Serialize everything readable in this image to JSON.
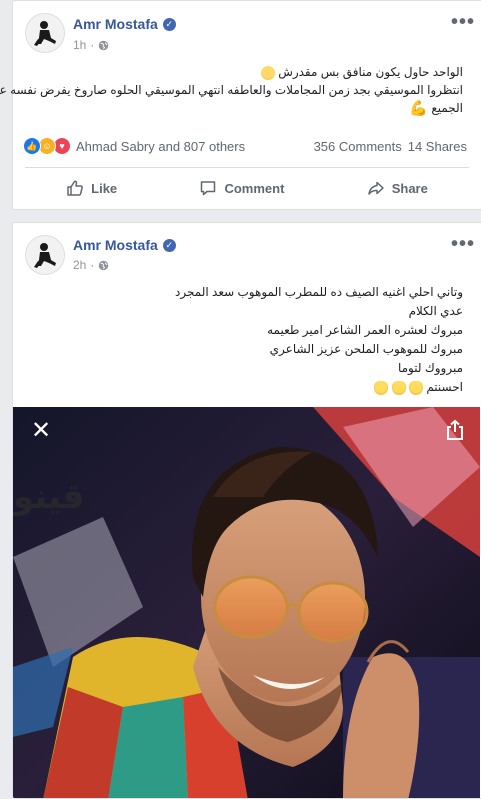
{
  "posts": [
    {
      "author": "Amr Mostafa",
      "time": "1h",
      "text_lines": [
        "الواحد حاول يكون منافق بس مقدرش",
        "انتظروا الموسيقي بجد زمن المجاملات والعاطفه انتهي الموسيقي الحلوه صاروخ يفرض نفسه علي",
        "الجميع"
      ],
      "reactions_text": "Ahmad Sabry and 807 others",
      "comments": "356 Comments",
      "shares": "14 Shares",
      "actions": {
        "like": "Like",
        "comment": "Comment",
        "share": "Share"
      }
    },
    {
      "author": "Amr Mostafa",
      "time": "2h",
      "text_lines": [
        "وتاني احلي اغنيه الصيف ده للمطرب الموهوب سعد المجرد",
        "عدي الكلام",
        "مبروك لعشره العمر الشاعر امير طعيمه",
        "مبروك للموهوب الملحن عزيز الشاعري",
        "مبرووك لتوما",
        "احسنتم"
      ],
      "photo": {
        "watermark": "ﻗﻴﻨﻮ"
      }
    }
  ],
  "icons": {
    "verified": "verified-badge-icon",
    "globe": "globe-icon",
    "more": "more-options-icon",
    "close": "close-icon",
    "share_photo": "share-icon"
  },
  "colors": {
    "link": "#365899",
    "like_blue": "#1877f2",
    "love_red": "#e9445a",
    "haha_yellow": "#f7b125"
  }
}
